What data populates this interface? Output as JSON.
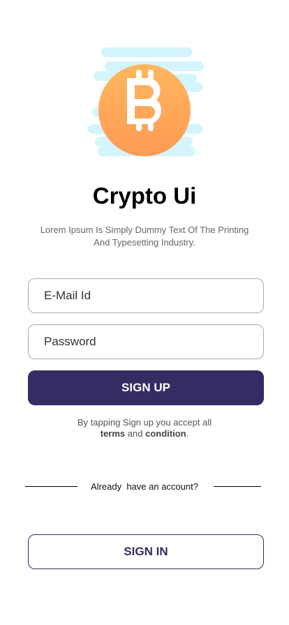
{
  "logo": {
    "icon": "bitcoin-icon",
    "colors": {
      "coin_top": "#ffb75e",
      "coin_bottom": "#ff9a55",
      "cloud": "#d3f5fb"
    }
  },
  "title": "Crypto Ui",
  "subtitle_line1": "Lorem Ipsum Is Simply Dummy Text Of The Printing",
  "subtitle_line2": "And Typesetting Industry.",
  "email_placeholder": "E-Mail Id",
  "password_placeholder": "Password",
  "signup_label": "SIGN UP",
  "terms": {
    "line1": "By tapping Sign up you accept all",
    "terms": "terms",
    "and": "and",
    "condition": "condition",
    "period": "."
  },
  "already": "Already  have an account?",
  "signin_label": "SIGN IN",
  "accent": "#362b63"
}
